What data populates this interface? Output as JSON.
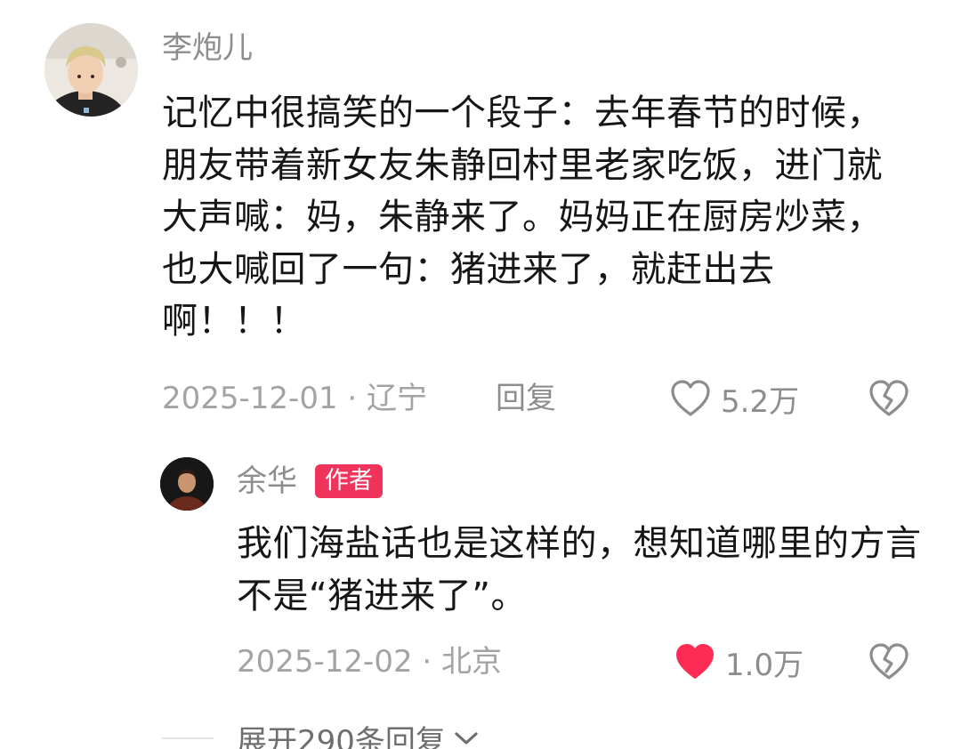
{
  "comment": {
    "username": "李炮儿",
    "avatar_icon": "user-avatar-photo",
    "text": "记忆中很搞笑的一个段子：去年春节的时候，朋友带着新女友朱静回村里老家吃饭，进门就大声喊：妈，朱静来了。妈妈正在厨房炒菜，也大喊回了一句：猪进来了，就赶出去啊！！！",
    "date": "2025-12-01",
    "separator": " · ",
    "location": "辽宁",
    "reply_label": "回复",
    "like_count": "5.2万",
    "liked": false,
    "like_icon": "heart-outline-icon",
    "dislike_icon": "broken-heart-icon"
  },
  "reply": {
    "username": "余华",
    "badge": "作者",
    "badge_color": "#f0335b",
    "avatar_icon": "user-avatar-photo",
    "text": "我们海盐话也是这样的，想知道哪里的方言不是“猪进来了”。",
    "date": "2025-12-02",
    "separator": " · ",
    "location": "北京",
    "like_count": "1.0万",
    "liked": true,
    "like_color": "#fe2c55",
    "like_icon": "heart-filled-icon",
    "dislike_icon": "broken-heart-icon"
  },
  "expand": {
    "label": "展开290条回复",
    "icon": "chevron-down-icon"
  }
}
